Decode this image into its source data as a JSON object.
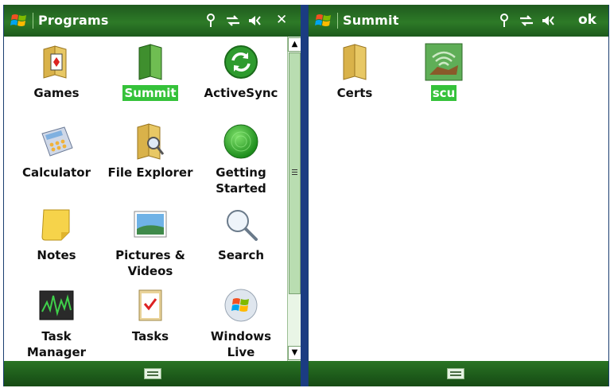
{
  "left_window": {
    "title": "Programs",
    "tray_close": "✕",
    "apps": [
      {
        "label": "Games",
        "icon": "games-folder-icon"
      },
      {
        "label": "Summit",
        "icon": "summit-folder-icon",
        "selected": true
      },
      {
        "label": "ActiveSync",
        "icon": "activesync-icon"
      },
      {
        "label": "Calculator",
        "icon": "calculator-icon"
      },
      {
        "label": "File Explorer",
        "icon": "file-explorer-icon"
      },
      {
        "label": "Getting Started",
        "label_l1": "Getting",
        "label_l2": "Started",
        "icon": "getting-started-icon"
      },
      {
        "label": "Notes",
        "icon": "notes-icon"
      },
      {
        "label": "Pictures & Videos",
        "label_l1": "Pictures &",
        "label_l2": "Videos",
        "icon": "pictures-videos-icon"
      },
      {
        "label": "Search",
        "icon": "search-icon"
      },
      {
        "label": "Task Manager",
        "label_l1": "Task",
        "label_l2": "Manager",
        "icon": "task-manager-icon"
      },
      {
        "label": "Tasks",
        "icon": "tasks-icon"
      },
      {
        "label": "Windows Live",
        "label_l1": "Windows",
        "label_l2": "Live",
        "icon": "windows-live-icon"
      }
    ]
  },
  "right_window": {
    "title": "Summit",
    "tray_ok": "ok",
    "apps": [
      {
        "label": "Certs",
        "icon": "certs-folder-icon"
      },
      {
        "label": "scu",
        "icon": "scu-icon",
        "selected": true
      }
    ]
  },
  "colors": {
    "titlebar": "#2d7a27",
    "selection": "#35c23a",
    "divider": "#1b3c82"
  }
}
